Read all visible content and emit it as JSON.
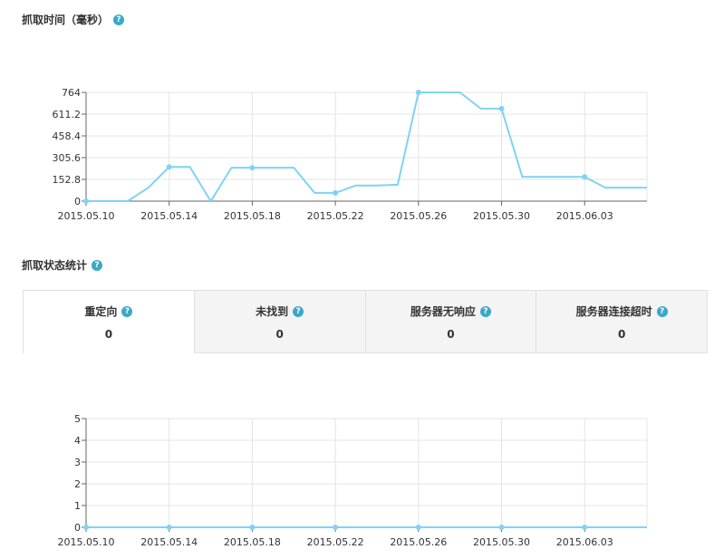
{
  "section1": {
    "title": "抓取时间（毫秒）"
  },
  "section2": {
    "title": "抓取状态统计"
  },
  "tabs": [
    {
      "label": "重定向",
      "value": "0",
      "active": true
    },
    {
      "label": "未找到",
      "value": "0",
      "active": false
    },
    {
      "label": "服务器无响应",
      "value": "0",
      "active": false
    },
    {
      "label": "服务器连接超时",
      "value": "0",
      "active": false
    }
  ],
  "colors": {
    "line": "#7fd3f4",
    "help": "#3aa9c9",
    "grid": "#e4e4e4"
  },
  "chart_data": [
    {
      "type": "line",
      "title": "抓取时间（毫秒）",
      "x": [
        "2015.05.10",
        "2015.05.11",
        "2015.05.12",
        "2015.05.13",
        "2015.05.14",
        "2015.05.15",
        "2015.05.16",
        "2015.05.17",
        "2015.05.18",
        "2015.05.19",
        "2015.05.20",
        "2015.05.21",
        "2015.05.22",
        "2015.05.23",
        "2015.05.24",
        "2015.05.25",
        "2015.05.26",
        "2015.05.27",
        "2015.05.28",
        "2015.05.29",
        "2015.05.30",
        "2015.05.31",
        "2015.06.01",
        "2015.06.02",
        "2015.06.03",
        "2015.06.04",
        "2015.06.05",
        "2015.06.06"
      ],
      "x_tick_labels": [
        "2015.05.10",
        "2015.05.14",
        "2015.05.18",
        "2015.05.22",
        "2015.05.26",
        "2015.05.30",
        "2015.06.03"
      ],
      "y_ticks": [
        "0",
        "152.8",
        "305.6",
        "458.4",
        "611.2",
        "764"
      ],
      "ylim": [
        0,
        764
      ],
      "series": [
        {
          "values": [
            0,
            0,
            0,
            95,
            240,
            240,
            0,
            235,
            235,
            235,
            235,
            58,
            58,
            110,
            110,
            115,
            764,
            764,
            764,
            650,
            650,
            170,
            170,
            170,
            170,
            95,
            95,
            95
          ]
        }
      ],
      "markers_at": [
        "2015.05.10",
        "2015.05.14",
        "2015.05.18",
        "2015.05.22",
        "2015.05.26",
        "2015.05.30",
        "2015.06.03"
      ],
      "grid": true
    },
    {
      "type": "line",
      "x": [
        "2015.05.10",
        "2015.05.11",
        "2015.05.12",
        "2015.05.13",
        "2015.05.14",
        "2015.05.15",
        "2015.05.16",
        "2015.05.17",
        "2015.05.18",
        "2015.05.19",
        "2015.05.20",
        "2015.05.21",
        "2015.05.22",
        "2015.05.23",
        "2015.05.24",
        "2015.05.25",
        "2015.05.26",
        "2015.05.27",
        "2015.05.28",
        "2015.05.29",
        "2015.05.30",
        "2015.05.31",
        "2015.06.01",
        "2015.06.02",
        "2015.06.03",
        "2015.06.04",
        "2015.06.05",
        "2015.06.06"
      ],
      "x_tick_labels": [
        "2015.05.10",
        "2015.05.14",
        "2015.05.18",
        "2015.05.22",
        "2015.05.26",
        "2015.05.30",
        "2015.06.03"
      ],
      "y_ticks": [
        "0",
        "1",
        "2",
        "3",
        "4",
        "5"
      ],
      "ylim": [
        0,
        5
      ],
      "series": [
        {
          "values": [
            0,
            0,
            0,
            0,
            0,
            0,
            0,
            0,
            0,
            0,
            0,
            0,
            0,
            0,
            0,
            0,
            0,
            0,
            0,
            0,
            0,
            0,
            0,
            0,
            0,
            0,
            0,
            0
          ]
        }
      ],
      "markers_at": [
        "2015.05.10",
        "2015.05.14",
        "2015.05.18",
        "2015.05.22",
        "2015.05.26",
        "2015.05.30",
        "2015.06.03"
      ],
      "grid": true
    }
  ]
}
